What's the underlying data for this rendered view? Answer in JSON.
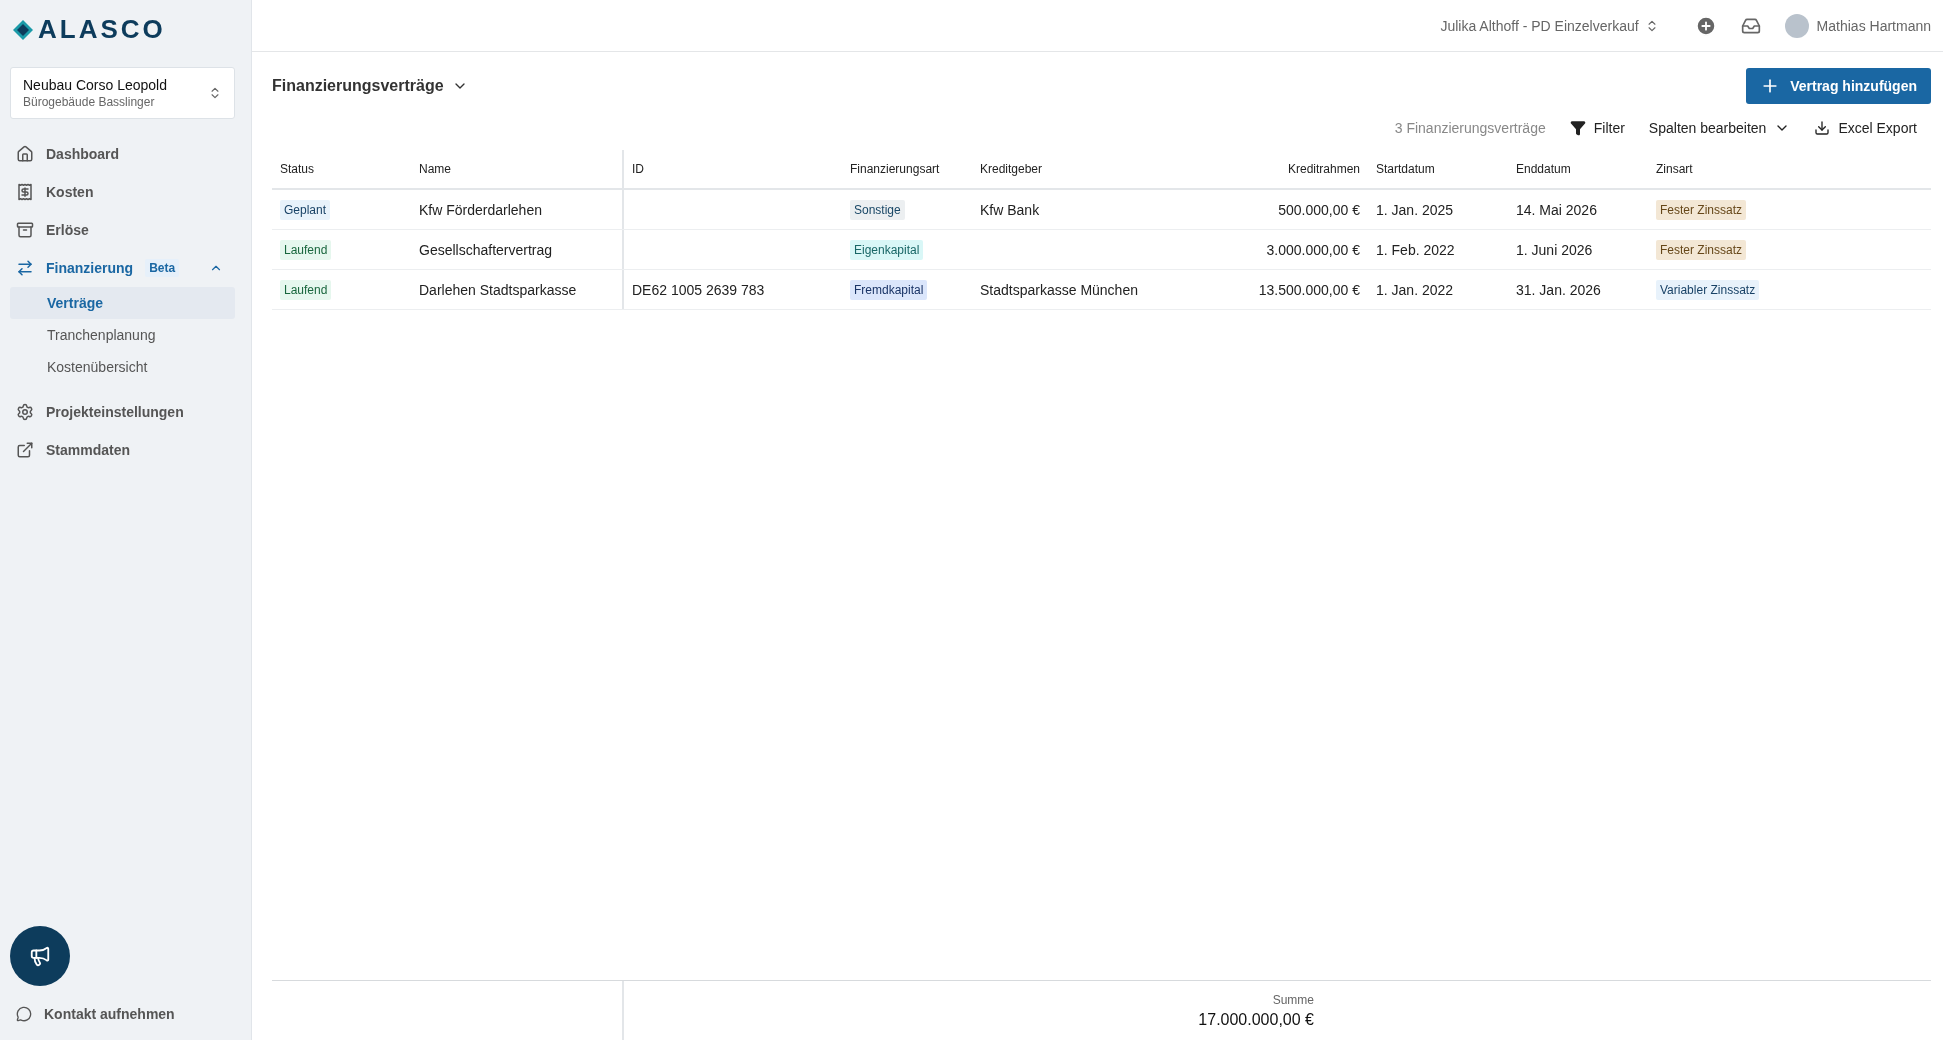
{
  "logo": {
    "text": "ALASCO"
  },
  "project": {
    "name": "Neubau Corso Leopold",
    "subtitle": "Bürogebäude Basslinger"
  },
  "nav": [
    {
      "kind": "home",
      "label": "Dashboard",
      "selected": false
    },
    {
      "kind": "costs",
      "label": "Kosten",
      "selected": false
    },
    {
      "kind": "revenue",
      "label": "Erlöse",
      "selected": false
    },
    {
      "kind": "finance",
      "label": "Finanzierung",
      "badge": "Beta",
      "selected": true,
      "expanded": true,
      "children": [
        {
          "label": "Verträge",
          "selected": true
        },
        {
          "label": "Tranchenplanung",
          "selected": false
        },
        {
          "label": "Kostenübersicht",
          "selected": false
        }
      ]
    },
    {
      "kind": "settings",
      "label": "Projekteinstellungen",
      "selected": false
    },
    {
      "kind": "external",
      "label": "Stammdaten",
      "selected": false
    }
  ],
  "contact": {
    "label": "Kontakt aufnehmen"
  },
  "header": {
    "organization": "Julika Althoff - PD Einzelverkauf",
    "user": "Mathias Hartmann"
  },
  "page": {
    "title": "Finanzierungsverträge",
    "add_button": "Vertrag hinzufügen",
    "count": "3 Finanzierungsverträge",
    "filter": "Filter",
    "columns_button": "Spalten bearbeiten",
    "export": "Excel Export"
  },
  "table": {
    "columns": [
      "Status",
      "Name",
      "ID",
      "Finanzierungsart",
      "Kreditgeber",
      "Kreditrahmen",
      "Startdatum",
      "Enddatum",
      "Zinsart"
    ],
    "rows": [
      {
        "status": {
          "text": "Geplant",
          "color": "#e8f2fb"
        },
        "name": "Kfw Förderdarlehen",
        "id": "",
        "type": {
          "text": "Sonstige",
          "color": "#eceff1"
        },
        "lender": "Kfw Bank",
        "amount": "500.000,00 €",
        "start": "1. Jan. 2025",
        "end": "14. Mai 2026",
        "rate": {
          "text": "Fester Zinssatz",
          "color": "#f3e7d5"
        }
      },
      {
        "status": {
          "text": "Laufend",
          "color": "#e6f7ee"
        },
        "name": "Gesellschaftervertrag",
        "id": "",
        "type": {
          "text": "Eigenkapital",
          "color": "#d9f7f7"
        },
        "lender": "",
        "amount": "3.000.000,00 €",
        "start": "1. Feb. 2022",
        "end": "1. Juni 2026",
        "rate": {
          "text": "Fester Zinssatz",
          "color": "#f3e7d5"
        }
      },
      {
        "status": {
          "text": "Laufend",
          "color": "#e6f7ee"
        },
        "name": "Darlehen Stadtsparkasse",
        "id": "DE62 1005 2639 783",
        "type": {
          "text": "Fremdkapital",
          "color": "#dbe6fb"
        },
        "lender": "Stadtsparkasse München",
        "amount": "13.500.000,00 €",
        "start": "1. Jan. 2022",
        "end": "31. Jan. 2026",
        "rate": {
          "text": "Variabler Zinssatz",
          "color": "#e8f2fb"
        }
      }
    ],
    "footer": {
      "label": "Summe",
      "value": "17.000.000,00 €"
    }
  }
}
